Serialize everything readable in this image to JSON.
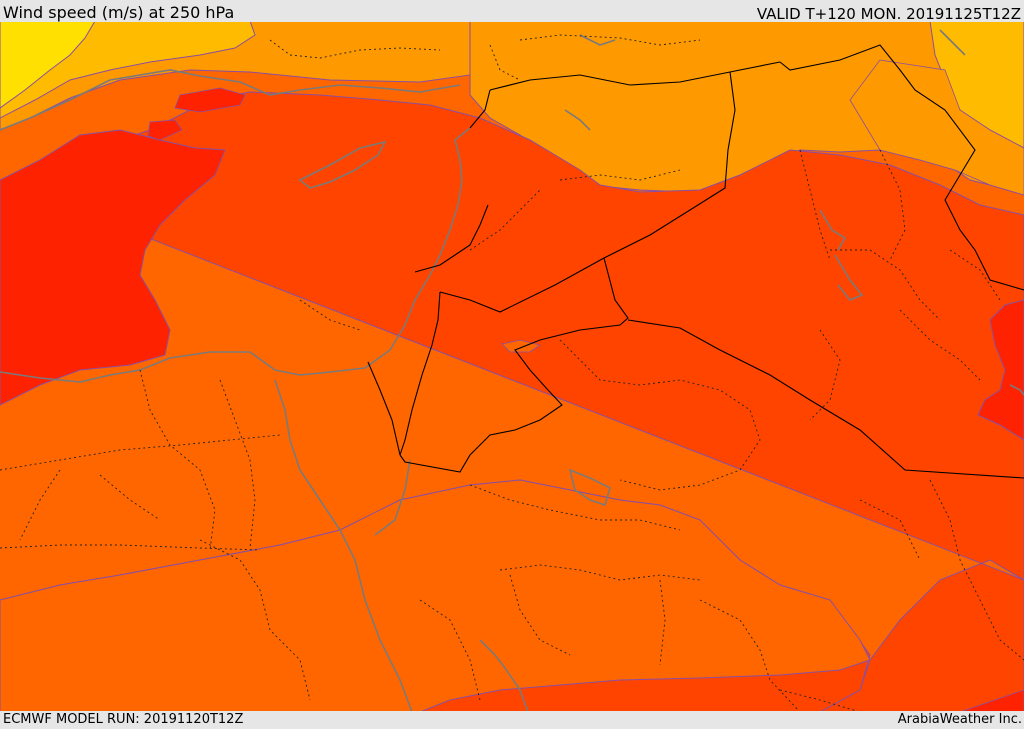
{
  "header": {
    "title": "Wind speed (m/s) at 250 hPa",
    "valid": "VALID T+120 MON. 20191125T12Z"
  },
  "footer": {
    "model_run": "ECMWF MODEL RUN: 20191120T12Z",
    "credit": "ArabiaWeather Inc."
  },
  "map": {
    "field": "wind speed at 250 hPa",
    "palette": {
      "bands_light_to_strong": [
        "#ffe000",
        "#ffbb00",
        "#ff9900",
        "#ff6600",
        "#ff4400",
        "#ff2200"
      ],
      "contour_line": "#8a4fa0",
      "coastline": "#7a7a7a",
      "border": "#000000"
    }
  }
}
